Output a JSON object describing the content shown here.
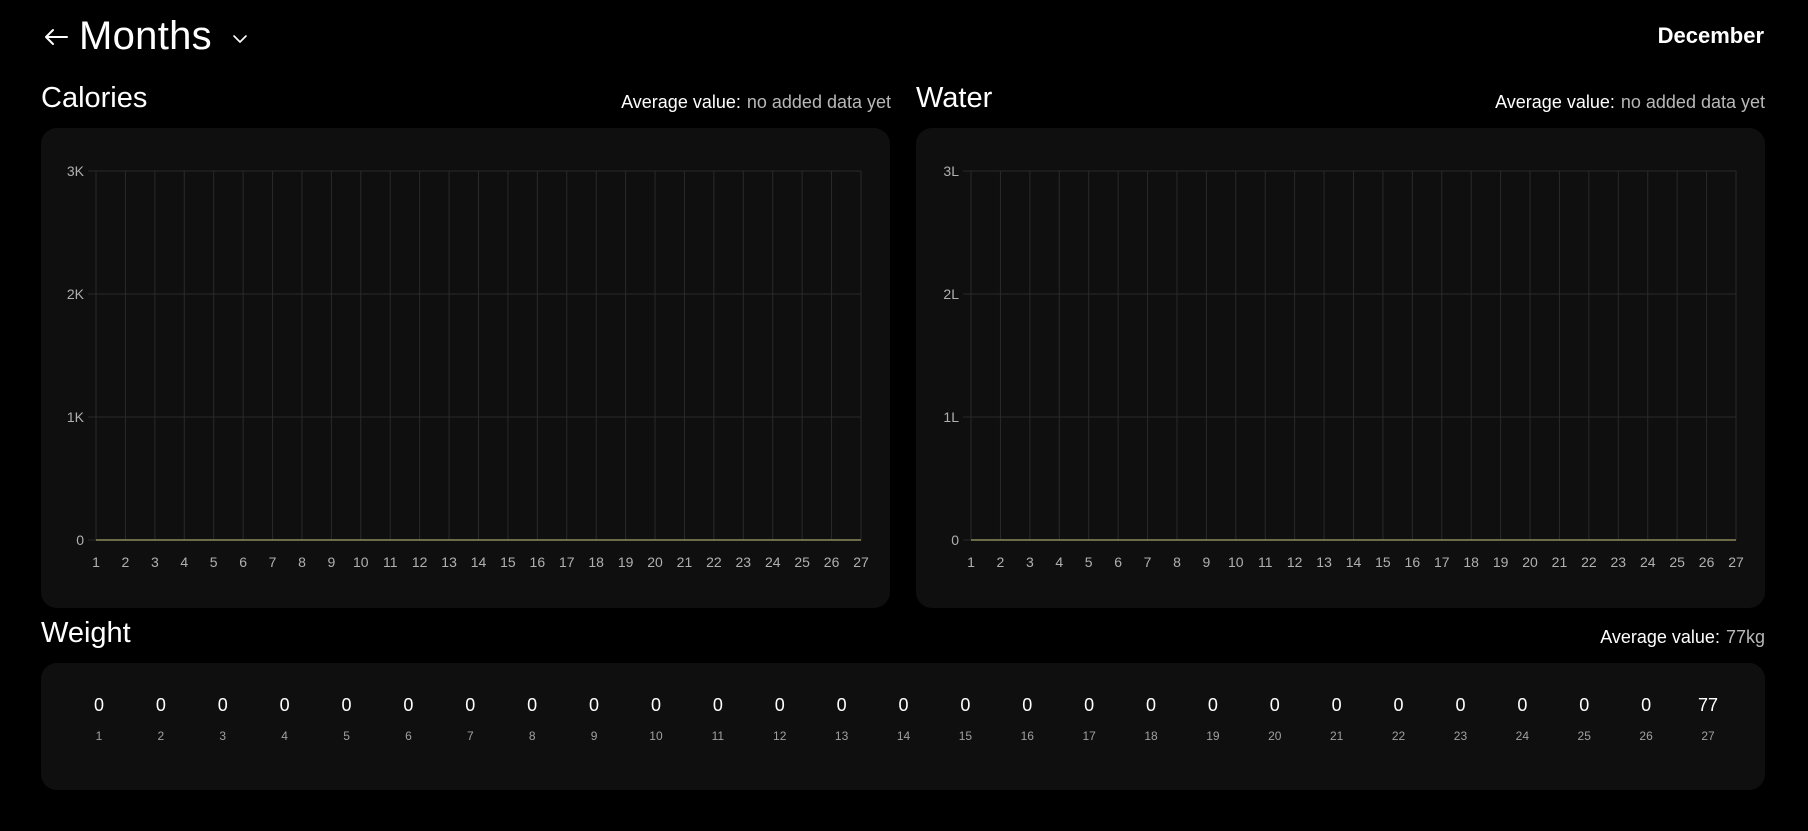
{
  "header": {
    "title": "Months",
    "month": "December"
  },
  "calories": {
    "title": "Calories",
    "avg_label": "Average value:",
    "avg_value": "no added data yet"
  },
  "water": {
    "title": "Water",
    "avg_label": "Average value:",
    "avg_value": "no added data yet"
  },
  "weight": {
    "title": "Weight",
    "avg_label": "Average value:",
    "avg_value": "77kg",
    "days": [
      "1",
      "2",
      "3",
      "4",
      "5",
      "6",
      "7",
      "8",
      "9",
      "10",
      "11",
      "12",
      "13",
      "14",
      "15",
      "16",
      "17",
      "18",
      "19",
      "20",
      "21",
      "22",
      "23",
      "24",
      "25",
      "26",
      "27"
    ],
    "values": [
      "0",
      "0",
      "0",
      "0",
      "0",
      "0",
      "0",
      "0",
      "0",
      "0",
      "0",
      "0",
      "0",
      "0",
      "0",
      "0",
      "0",
      "0",
      "0",
      "0",
      "0",
      "0",
      "0",
      "0",
      "0",
      "0",
      "77"
    ]
  },
  "colors": {
    "background": "#000000",
    "panel": "#0f0f0f",
    "grid": "#2a2a2a",
    "line": "#8a8a5a"
  },
  "chart_data": [
    {
      "type": "line",
      "name": "calories",
      "x": [
        1,
        2,
        3,
        4,
        5,
        6,
        7,
        8,
        9,
        10,
        11,
        12,
        13,
        14,
        15,
        16,
        17,
        18,
        19,
        20,
        21,
        22,
        23,
        24,
        25,
        26,
        27
      ],
      "categories": [
        "1",
        "2",
        "3",
        "4",
        "5",
        "6",
        "7",
        "8",
        "9",
        "10",
        "11",
        "12",
        "13",
        "14",
        "15",
        "16",
        "17",
        "18",
        "19",
        "20",
        "21",
        "22",
        "23",
        "24",
        "25",
        "26",
        "27"
      ],
      "series": [
        {
          "values": [
            0,
            0,
            0,
            0,
            0,
            0,
            0,
            0,
            0,
            0,
            0,
            0,
            0,
            0,
            0,
            0,
            0,
            0,
            0,
            0,
            0,
            0,
            0,
            0,
            0,
            0,
            0
          ]
        }
      ],
      "ylim": [
        0,
        3000
      ],
      "yticks": [
        0,
        1000,
        2000,
        3000
      ],
      "ytick_labels": [
        "0",
        "1K",
        "2K",
        "3K"
      ],
      "grid": true
    },
    {
      "type": "line",
      "name": "water",
      "x": [
        1,
        2,
        3,
        4,
        5,
        6,
        7,
        8,
        9,
        10,
        11,
        12,
        13,
        14,
        15,
        16,
        17,
        18,
        19,
        20,
        21,
        22,
        23,
        24,
        25,
        26,
        27
      ],
      "categories": [
        "1",
        "2",
        "3",
        "4",
        "5",
        "6",
        "7",
        "8",
        "9",
        "10",
        "11",
        "12",
        "13",
        "14",
        "15",
        "16",
        "17",
        "18",
        "19",
        "20",
        "21",
        "22",
        "23",
        "24",
        "25",
        "26",
        "27"
      ],
      "series": [
        {
          "values": [
            0,
            0,
            0,
            0,
            0,
            0,
            0,
            0,
            0,
            0,
            0,
            0,
            0,
            0,
            0,
            0,
            0,
            0,
            0,
            0,
            0,
            0,
            0,
            0,
            0,
            0,
            0
          ]
        }
      ],
      "ylim": [
        0,
        3
      ],
      "yticks": [
        0,
        1,
        2,
        3
      ],
      "ytick_labels": [
        "0",
        "1L",
        "2L",
        "3L"
      ],
      "grid": true
    }
  ]
}
